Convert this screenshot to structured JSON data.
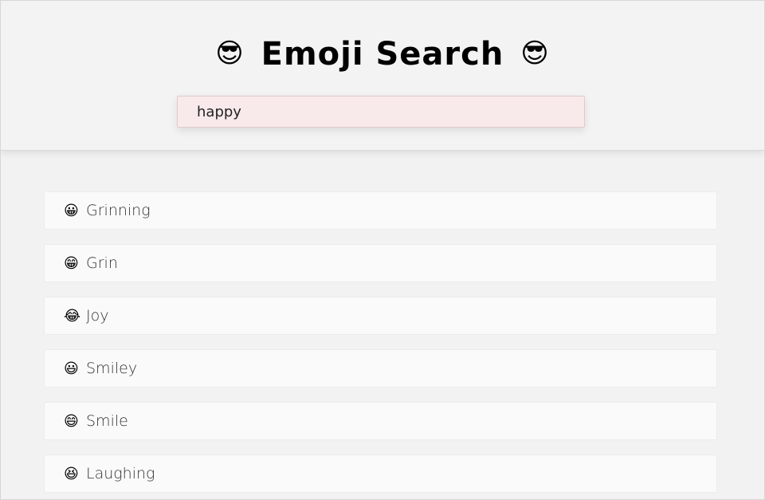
{
  "header": {
    "title": "Emoji Search",
    "title_emoji_left": "😎",
    "title_emoji_right": "😎"
  },
  "search": {
    "value": "happy"
  },
  "results": [
    {
      "emoji": "😀",
      "label": "Grinning"
    },
    {
      "emoji": "😁",
      "label": "Grin"
    },
    {
      "emoji": "😂",
      "label": "Joy"
    },
    {
      "emoji": "😃",
      "label": "Smiley"
    },
    {
      "emoji": "😄",
      "label": "Smile"
    },
    {
      "emoji": "😆",
      "label": "Laughing"
    }
  ],
  "colors": {
    "search_background": "#f8eaeb",
    "page_background": "#f2f2f2",
    "row_background": "#fafafa"
  }
}
